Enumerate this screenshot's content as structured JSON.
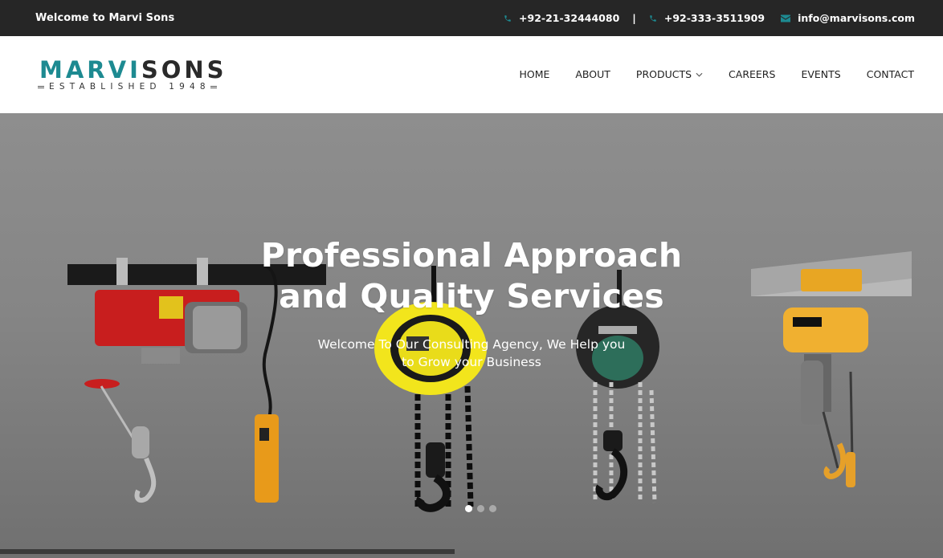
{
  "topbar": {
    "welcome": "Welcome to Marvi Sons",
    "phone1": "+92-21-32444080",
    "separator": "|",
    "phone2": "+92-333-3511909",
    "email": "info@marvisons.com",
    "icons": [
      "phone-icon",
      "phone-icon",
      "envelope-icon"
    ],
    "accent_color": "#1d8a91"
  },
  "logo": {
    "brand_part1": "MARVI",
    "brand_part2": "SONS",
    "tagline": "ESTABLISHED 1948"
  },
  "nav": {
    "items": [
      {
        "label": "HOME"
      },
      {
        "label": "ABOUT"
      },
      {
        "label": "PRODUCTS"
      },
      {
        "label": "CAREERS"
      },
      {
        "label": "EVENTS"
      },
      {
        "label": "CONTACT"
      }
    ]
  },
  "hero": {
    "title_line1": "Professional Approach",
    "title_line2": "and Quality Services",
    "subtitle_line1": "Welcome To Our Consulting Agency, We Help you",
    "subtitle_line2": "to Grow your Business",
    "slides_count": 3,
    "active_slide": 1,
    "products": [
      "electric-wire-rope-hoist",
      "yellow-manual-chain-hoist",
      "black-manual-chain-hoist",
      "electric-chain-hoist-on-trolley"
    ]
  }
}
